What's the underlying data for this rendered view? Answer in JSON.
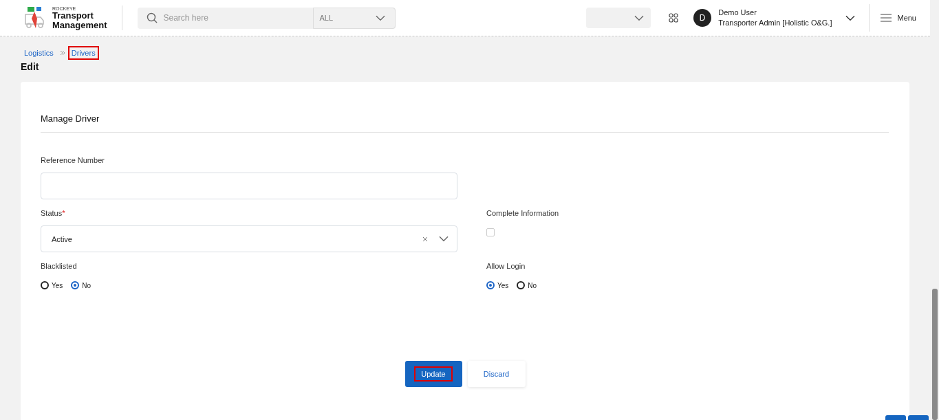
{
  "header": {
    "brand": "ROCKEYE",
    "title_line1": "Transport",
    "title_line2": "Management",
    "search": {
      "placeholder": "Search here",
      "filter": "ALL"
    },
    "user": {
      "initial": "D",
      "name": "Demo User",
      "role": "Transporter Admin [Holistic O&G.]"
    },
    "menu": "Menu"
  },
  "breadcrumb": [
    {
      "label": "Logistics",
      "highlighted": false
    },
    {
      "label": "Drivers",
      "highlighted": true
    }
  ],
  "page_title": "Edit",
  "form": {
    "title": "Manage Driver",
    "reference_number": {
      "label": "Reference Number"
    },
    "status": {
      "label": "Status",
      "required_mark": "*",
      "value": "Active"
    },
    "complete_information": {
      "label": "Complete Information",
      "checked": false
    },
    "blacklisted": {
      "label": "Blacklisted",
      "options": [
        {
          "label": "Yes",
          "selected": false
        },
        {
          "label": "No",
          "selected": true
        }
      ]
    },
    "allow_login": {
      "label": "Allow Login",
      "options": [
        {
          "label": "Yes",
          "selected": true
        },
        {
          "label": "No",
          "selected": false
        }
      ]
    }
  },
  "buttons": [
    {
      "label": "Update",
      "kind": "primary",
      "highlighted": true
    },
    {
      "label": "Discard",
      "kind": "secondary",
      "highlighted": false
    }
  ]
}
